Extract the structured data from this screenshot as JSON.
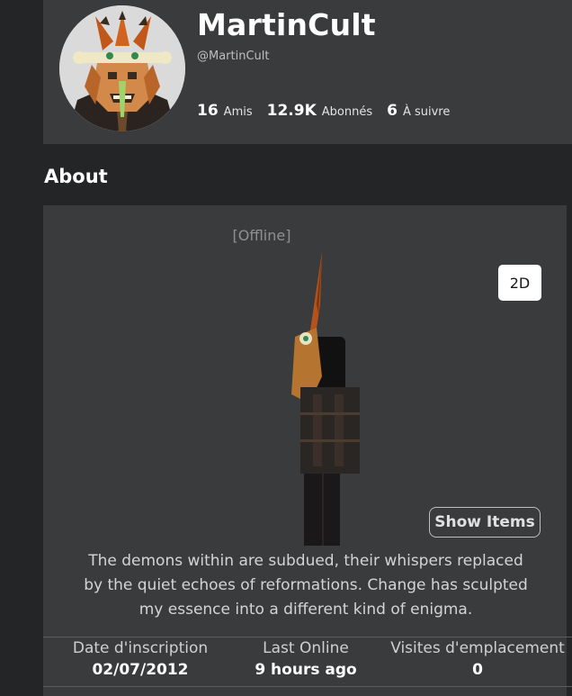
{
  "profile": {
    "display_name": "MartinCult",
    "username": "@MartinCult",
    "stats": [
      {
        "value": "16",
        "label": "Amis"
      },
      {
        "value": "12.9K",
        "label": "Abonnés"
      },
      {
        "value": "6",
        "label": "À suivre"
      }
    ]
  },
  "about": {
    "title": "About",
    "status": "[Offline]",
    "view_toggle": "2D",
    "show_items": "Show Items",
    "description_lines": [
      "The demons within are subdued, their whispers replaced",
      "by the quiet echoes of reformations. Change has sculpted",
      "my essence into a different kind of enigma."
    ],
    "info": [
      {
        "label": "Date d'inscription",
        "value": "02/07/2012"
      },
      {
        "label": "Last Online",
        "value": "9 hours ago"
      },
      {
        "label": "Visites d'emplacement",
        "value": "0"
      }
    ]
  }
}
